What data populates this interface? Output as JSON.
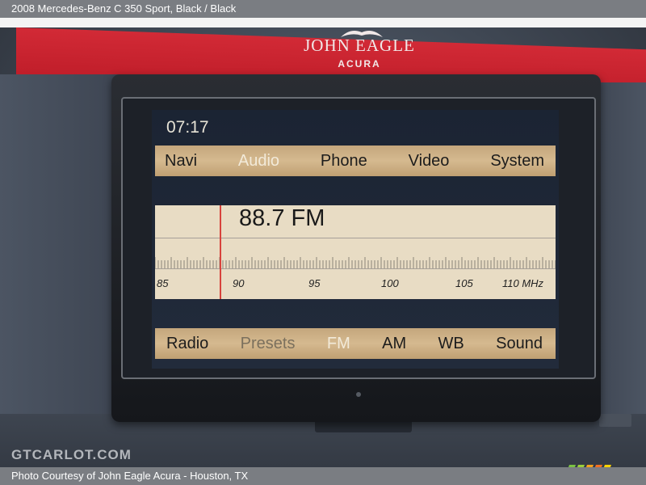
{
  "header": {
    "caption": "2008 Mercedes-Benz C 350 Sport,  Black / Black"
  },
  "footer": {
    "credit": "Photo Courtesy of John Eagle Acura - Houston, TX"
  },
  "dealer_sign": {
    "name": "JOHN EAGLE",
    "sub": "ACURA"
  },
  "display": {
    "clock": "07:17",
    "main_menu": [
      "Navi",
      "Audio",
      "Phone",
      "Video",
      "System"
    ],
    "active_main": "Audio",
    "frequency": "88.7 FM",
    "scale": [
      "85",
      "90",
      "95",
      "100",
      "105",
      "110 MHz"
    ],
    "bottom_menu": [
      "Radio",
      "Presets",
      "FM",
      "AM",
      "WB",
      "Sound"
    ],
    "active_bottom": "FM"
  },
  "watermark": "GTCARLOT.COM",
  "colors": {
    "menu_bar": "#d5b98f",
    "needle": "#d8423c",
    "tuner_bg": "#e8dcc4",
    "sign": "#c51f2c"
  }
}
